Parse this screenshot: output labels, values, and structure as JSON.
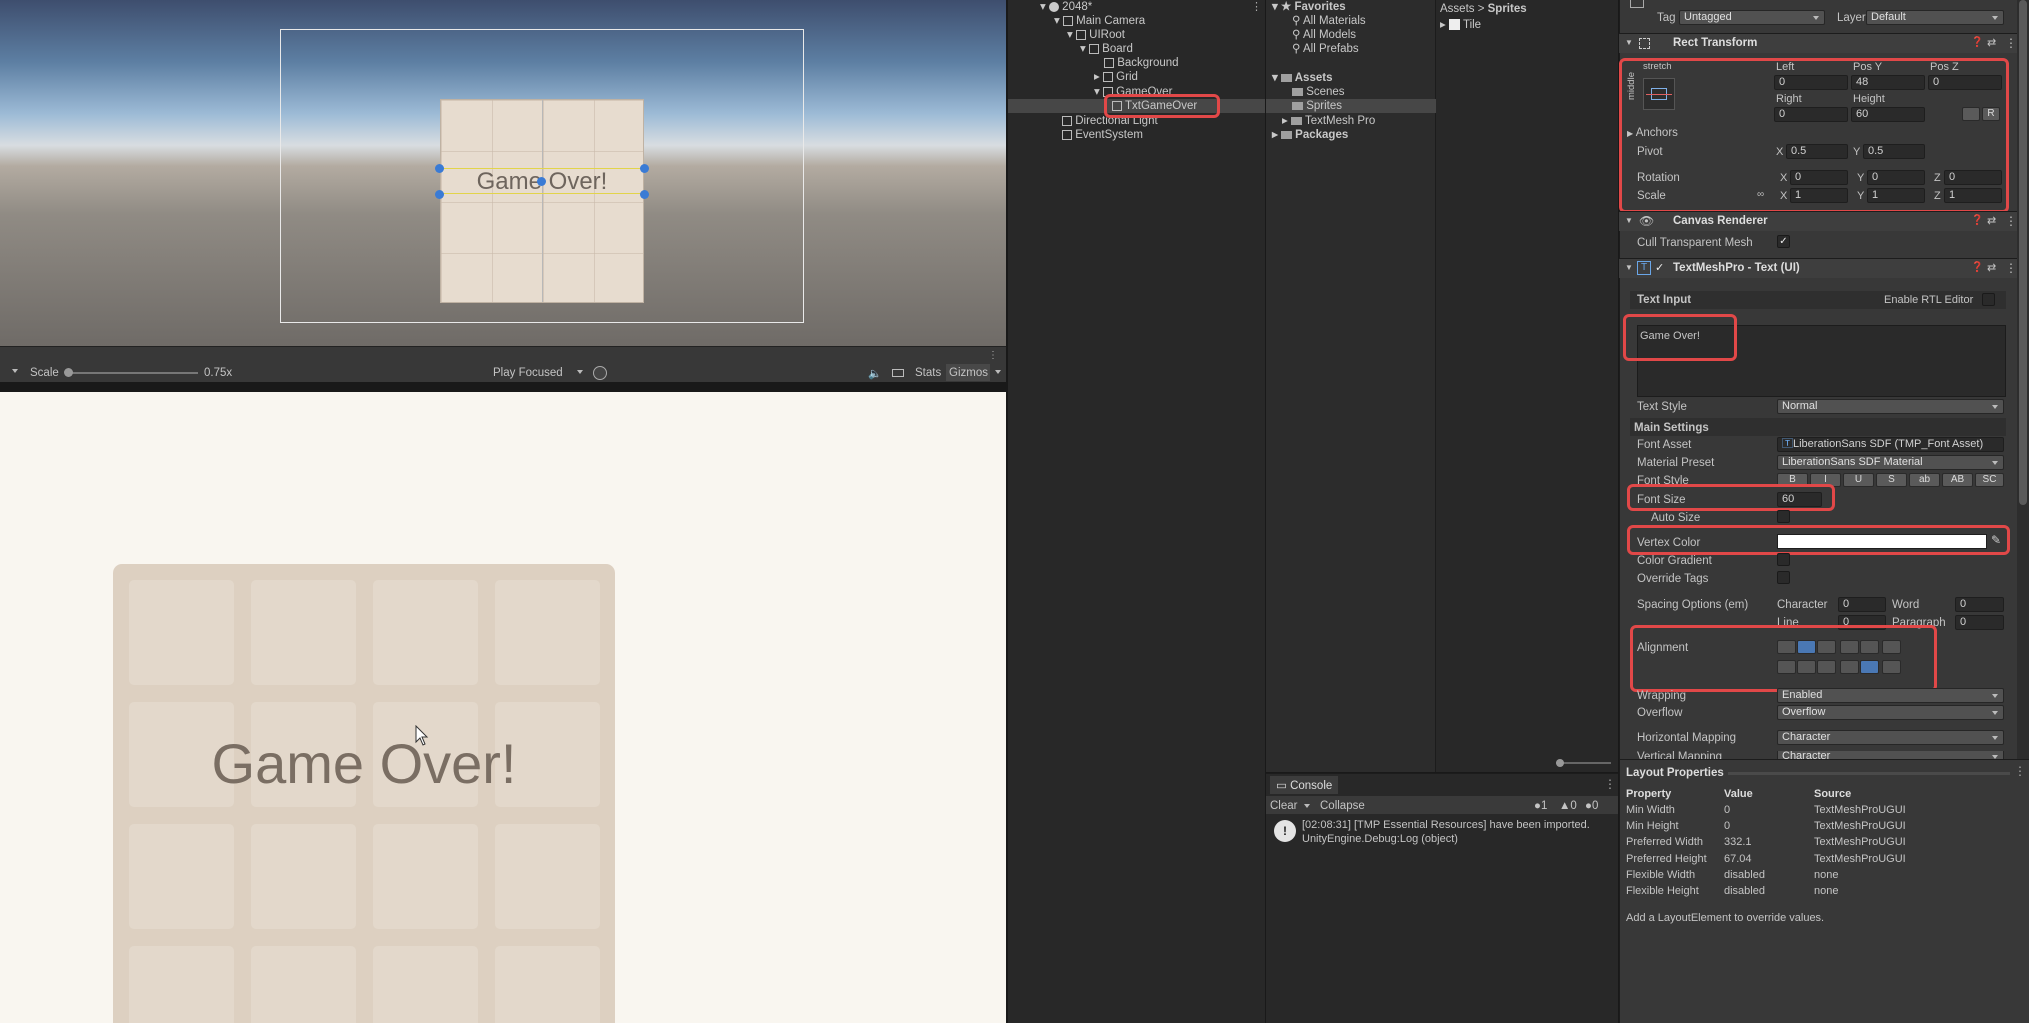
{
  "scene": {
    "game_text": "Game Over!"
  },
  "game_toolbar": {
    "scale_label": "Scale",
    "scale_value": "0.75x",
    "play_mode": "Play Focused",
    "stats": "Stats",
    "gizmos": "Gizmos"
  },
  "game": {
    "text": "Game Over!"
  },
  "hierarchy": {
    "rows": [
      {
        "label": "2048*"
      },
      {
        "label": "Main Camera"
      },
      {
        "label": "UIRoot"
      },
      {
        "label": "Board"
      },
      {
        "label": "Background"
      },
      {
        "label": "Grid"
      },
      {
        "label": "GameOver"
      },
      {
        "label": "TxtGameOver"
      },
      {
        "label": "Directional Light"
      },
      {
        "label": "EventSystem"
      }
    ]
  },
  "project": {
    "favorites": [
      "Favorites",
      "All Materials",
      "All Models",
      "All Prefabs"
    ],
    "assets": [
      "Assets",
      "Scenes",
      "Sprites",
      "TextMesh Pro",
      "Packages"
    ],
    "breadcrumb_root": "Assets",
    "breadcrumb_sep": ">",
    "breadcrumb_leaf": "Sprites",
    "files": [
      "Tile"
    ]
  },
  "console": {
    "tab": "Console",
    "clear": "Clear",
    "collapse": "Collapse",
    "count_log": "1",
    "count_warn": "0",
    "count_err": "0",
    "message_line1": "[02:08:31] [TMP Essential Resources] have been imported.",
    "message_line2": "UnityEngine.Debug:Log (object)"
  },
  "inspector": {
    "tag_label": "Tag",
    "tag_value": "Untagged",
    "layer_label": "Layer",
    "layer_value": "Default",
    "rect_transform": {
      "title": "Rect Transform",
      "anchor_preset_top": "stretch",
      "anchor_preset_side": "middle",
      "left_label": "Left",
      "posy_label": "Pos Y",
      "posz_label": "Pos Z",
      "left": "0",
      "posy": "48",
      "posz": "0",
      "right_label": "Right",
      "height_label": "Height",
      "right": "0",
      "height": "60",
      "r_btn": "R",
      "anchors": "Anchors",
      "pivot": "Pivot",
      "pivot_x": "0.5",
      "pivot_y": "0.5",
      "rotation": "Rotation",
      "rot_x": "0",
      "rot_y": "0",
      "rot_z": "0",
      "scale": "Scale",
      "scale_x": "1",
      "scale_y": "1",
      "scale_z": "1",
      "x": "X",
      "y": "Y",
      "z": "Z"
    },
    "canvas_renderer": {
      "title": "Canvas Renderer",
      "cull": "Cull Transparent Mesh"
    },
    "tmp": {
      "title": "TextMeshPro - Text (UI)",
      "text_input": "Text Input",
      "rtl": "Enable RTL Editor",
      "text": "Game Over!",
      "text_style_label": "Text Style",
      "text_style": "Normal",
      "main_settings": "Main Settings",
      "font_asset_label": "Font Asset",
      "font_asset": "LiberationSans SDF (TMP_Font Asset)",
      "material_label": "Material Preset",
      "material": "LiberationSans SDF Material",
      "font_style_label": "Font Style",
      "font_style_buttons": [
        "B",
        "I",
        "U",
        "S",
        "ab",
        "AB",
        "SC"
      ],
      "font_size_label": "Font Size",
      "font_size": "60",
      "auto_size": "Auto Size",
      "vertex_color": "Vertex Color",
      "color_gradient": "Color Gradient",
      "override_tags": "Override Tags",
      "spacing_label": "Spacing Options (em)",
      "character_label": "Character",
      "character": "0",
      "word_label": "Word",
      "word": "0",
      "line_label": "Line",
      "line": "0",
      "paragraph_label": "Paragraph",
      "paragraph": "0",
      "alignment": "Alignment",
      "wrapping_label": "Wrapping",
      "wrapping": "Enabled",
      "overflow_label": "Overflow",
      "overflow": "Overflow",
      "hmap_label": "Horizontal Mapping",
      "hmap": "Character",
      "vmap_label": "Vertical Mapping",
      "vmap": "Character"
    },
    "layout": {
      "title": "Layout Properties",
      "headers": [
        "Property",
        "Value",
        "Source"
      ],
      "rows": [
        [
          "Min Width",
          "0",
          "TextMeshProUGUI"
        ],
        [
          "Min Height",
          "0",
          "TextMeshProUGUI"
        ],
        [
          "Preferred Width",
          "332.1",
          "TextMeshProUGUI"
        ],
        [
          "Preferred Height",
          "67.04",
          "TextMeshProUGUI"
        ],
        [
          "Flexible Width",
          "disabled",
          "none"
        ],
        [
          "Flexible Height",
          "disabled",
          "none"
        ]
      ],
      "footer": "Add a LayoutElement to override values."
    }
  },
  "colors": {
    "highlight": "#e14848",
    "selection": "#2c5d87",
    "game_bg": "#f9f6f0",
    "tile": "#e3d8cb",
    "board": "#ddd0c1",
    "game_text": "#7a6e63"
  }
}
